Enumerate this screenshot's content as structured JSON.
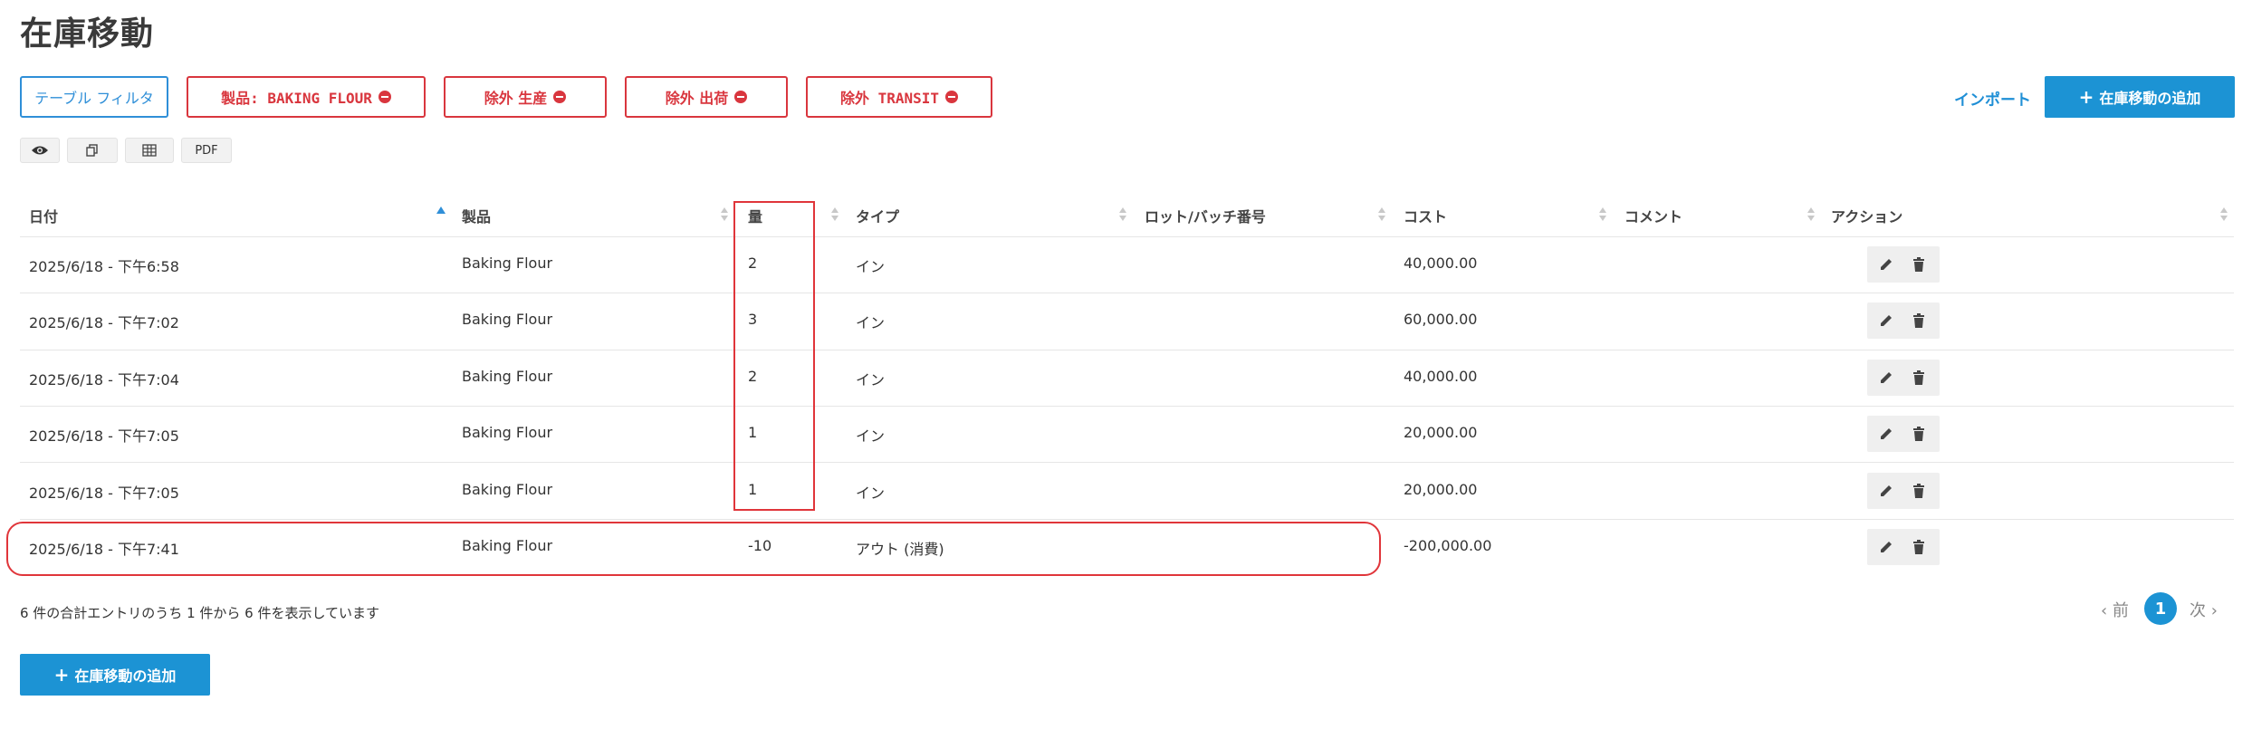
{
  "page": {
    "title": "在庫移動"
  },
  "filters": {
    "table_filter": "テーブル フィルタ",
    "chips": [
      {
        "label": "製品: BAKING FLOUR"
      },
      {
        "label": "除外 生産"
      },
      {
        "label": "除外 出荷"
      },
      {
        "label": "除外 TRANSIT"
      }
    ]
  },
  "toolbar": {
    "import": "インポート",
    "add": "在庫移動の追加",
    "pdf": "PDF"
  },
  "table": {
    "headers": {
      "date": "日付",
      "product": "製品",
      "quantity": "量",
      "type": "タイプ",
      "lot": "ロット/バッチ番号",
      "cost": "コスト",
      "comment": "コメント",
      "action": "アクション"
    },
    "rows": [
      {
        "date": "2025/6/18 - 下午6:58",
        "product": "Baking Flour",
        "quantity": "2",
        "type": "イン",
        "lot": "",
        "cost": "40,000.00",
        "comment": ""
      },
      {
        "date": "2025/6/18 - 下午7:02",
        "product": "Baking Flour",
        "quantity": "3",
        "type": "イン",
        "lot": "",
        "cost": "60,000.00",
        "comment": ""
      },
      {
        "date": "2025/6/18 - 下午7:04",
        "product": "Baking Flour",
        "quantity": "2",
        "type": "イン",
        "lot": "",
        "cost": "40,000.00",
        "comment": ""
      },
      {
        "date": "2025/6/18 - 下午7:05",
        "product": "Baking Flour",
        "quantity": "1",
        "type": "イン",
        "lot": "",
        "cost": "20,000.00",
        "comment": ""
      },
      {
        "date": "2025/6/18 - 下午7:05",
        "product": "Baking Flour",
        "quantity": "1",
        "type": "イン",
        "lot": "",
        "cost": "20,000.00",
        "comment": ""
      },
      {
        "date": "2025/6/18 - 下午7:41",
        "product": "Baking Flour",
        "quantity": "-10",
        "type": "アウト (消費)",
        "lot": "",
        "cost": "-200,000.00",
        "comment": ""
      }
    ]
  },
  "footer": {
    "summary": "6 件の合計エントリのうち 1 件から 6 件を表示しています",
    "prev": "‹ 前",
    "page": "1",
    "next": "次 ›",
    "add": "在庫移動の追加"
  },
  "colors": {
    "accent": "#1c93d4",
    "danger": "#d9363e",
    "highlight": "#e0353a"
  },
  "icons": [
    "eye-icon",
    "copy-icon",
    "table-icon",
    "pencil-icon",
    "trash-icon",
    "plus-icon",
    "minus-circle-icon",
    "sort-icon"
  ]
}
